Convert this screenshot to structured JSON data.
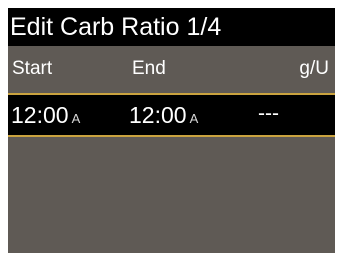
{
  "header": {
    "title": "Edit Carb Ratio 1/4"
  },
  "columns": {
    "start": "Start",
    "end": "End",
    "unit": "g/U"
  },
  "rows": [
    {
      "start_time": "12:00",
      "start_ampm": "A",
      "end_time": "12:00",
      "end_ampm": "A",
      "ratio": "---"
    }
  ],
  "colors": {
    "screen_background": "#5f5a55",
    "title_background": "#000000",
    "selected_row_background": "#000000",
    "selection_border": "#caa33f",
    "text": "#ffffff"
  }
}
